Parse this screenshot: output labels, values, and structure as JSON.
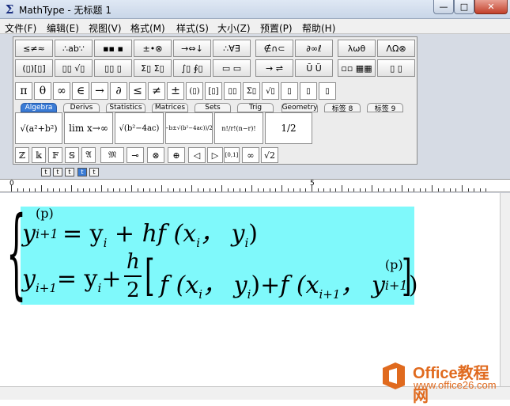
{
  "window": {
    "title": "MathType - 无标题 1",
    "app_icon": "Σ",
    "min": "—",
    "max": "□",
    "close": "✕"
  },
  "menu": [
    "文件(F)",
    "编辑(E)",
    "视图(V)",
    "格式(M)",
    "样式(S)",
    "大小(Z)",
    "预置(P)",
    "帮助(H)"
  ],
  "symbol_palette_row1": [
    "≤≠≈",
    "∴ab∵",
    "▪▪ ▪",
    "±•⊗",
    "→⇔↓",
    "∴∀∃",
    "∉∩⊂",
    "∂∞ℓ",
    "λωθ",
    "ΛΩ⊗"
  ],
  "symbol_palette_row2": [
    "(▯)[▯]",
    "▯▯ √▯",
    "▯▯ ▯",
    "Σ▯ Σ▯",
    "∫▯ ∮▯",
    "▭ ▭",
    "→ ⇌",
    "Ū Ũ",
    "▫▫ ▦▦",
    "▯ ▯"
  ],
  "small_bar": [
    "π",
    "θ",
    "∞",
    "∈",
    "→",
    "∂",
    "≤",
    "≠",
    "±",
    "(▯)",
    "[▯]",
    "▯▯",
    "Σ▯",
    "√▯",
    "▯",
    "▯",
    "▯"
  ],
  "tabs": [
    "Algebra",
    "Derivs",
    "Statistics",
    "Matrices",
    "Sets",
    "Trig",
    "Geometry",
    "标签 8",
    "标签 9"
  ],
  "templates": [
    "√(a²+b²)",
    "lim x→∞",
    "√(b²−4ac)",
    "(−b±√(b²−4ac))/2a",
    "n!/r!(n−r)!",
    "1/2"
  ],
  "small_bar2": [
    "ℤ",
    "𝕜",
    "𝔽",
    "𝕊",
    "𝔄",
    "𝔐",
    "⊸",
    "⊗",
    "⊕",
    "◁",
    "▷",
    "[0,1]",
    "∞",
    "√2"
  ],
  "size_buttons": [
    "t",
    "t",
    "t",
    "t",
    "t"
  ],
  "ruler": {
    "mark_0": "0",
    "mark_5": "5"
  },
  "equation": {
    "line1": {
      "lhs": "y",
      "lhs_sub": "i+1",
      "lhs_sup": "(p)",
      "rhs": "= y",
      "rhs_sub": "i",
      "rest": " + hf (x",
      "x_sub": "i",
      "sep": "， y",
      "y_sub": "i",
      "close": ")"
    },
    "line2": {
      "lhs": "y",
      "lhs_sub": "i+1",
      "eq": "= y",
      "y_sub": "i",
      "plus": "+",
      "frac_num": "h",
      "frac_den": "2",
      "open": "[",
      "f1": "f (x",
      "f1_sub": "i",
      "f1_sep": "， y",
      "f1_ysub": "i",
      "f1_close": ")",
      "plus2": "+",
      "f2": "f (x",
      "f2_sub": "i+1",
      "f2_sep": "， y",
      "f2_ysub": "i+1",
      "f2_sup": "(p)",
      "f2_close": ")",
      "close": "]"
    }
  },
  "watermark": {
    "title": "Office教程网",
    "url": "www.office26.com"
  },
  "colors": {
    "selection": "#7ff9fb",
    "watermark": "#e06a1e",
    "active_tab": "#3a7bd5"
  }
}
